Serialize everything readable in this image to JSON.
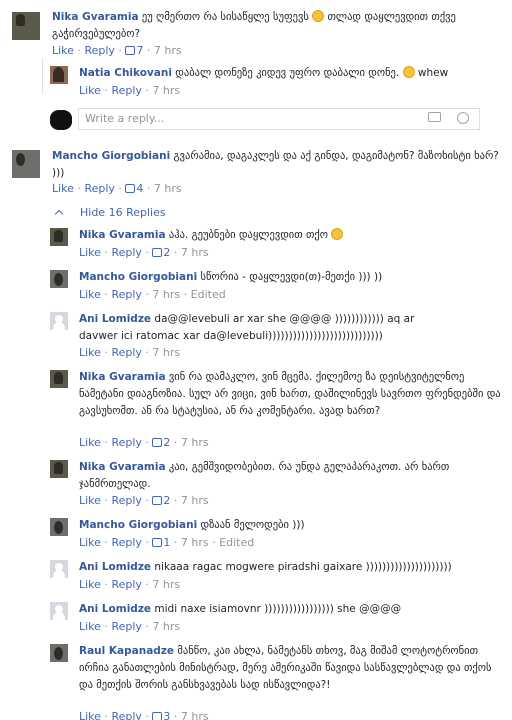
{
  "actions": {
    "like": "Like",
    "reply": "Reply",
    "sep": " · ",
    "edited": "Edited"
  },
  "reply_placeholder": "Write a reply...",
  "hide_replies": "Hide 16 Replies",
  "comments": [
    {
      "author": "Nika Gvaramia",
      "text1": "ეუ ღმერთო რა სისაწყლე სუფევს ",
      "text2": " თლად დაყლევდით თქვე გაჭირვებულებო?",
      "likes": "7",
      "time": "7 hrs"
    },
    {
      "author": "Natia Chikovani",
      "text1": "დაბალ დონეზე კიდევ უფრო დაბალი დონე. ",
      "text2": " whew",
      "time": "7 hrs"
    },
    {
      "author": "Mancho Giorgobiani",
      "text": "გვარამია, დაგაკლეს და აქ გინდა, დაგიმატონ? მაზოხისტი ხარ? )))",
      "likes": "4",
      "time": "7 hrs"
    },
    {
      "author": "Nika Gvaramia",
      "text1": "აჰა. გეუბნები დაყლევდით თქო ",
      "likes": "2",
      "time": "7 hrs"
    },
    {
      "author": "Mancho Giorgobiani",
      "text": "სწორია - დაყლევდი(თ)-მეთქი ))) ))",
      "time": "7 hrs"
    },
    {
      "author": "Ani Lomidze",
      "text": "da@@levebuli ar xar she @@@@ )))))))))))) aq ar davwer ici ratomac xar da@levebuli))))))))))))))))))))))))))))",
      "time": "7 hrs"
    },
    {
      "author": "Nika Gvaramia",
      "text": "ვინ რა დამაკლო, ვინ მცემა. ქილემოე ზა დეისტვიტელნოე ნამეტანი დიაგნოზია. სულ არ ვიცი, ვინ ხართ, დაშილინევს სავრთო ფრენდებში და გავსუხომთ. ან რა სტატუსია, ან რა კომენტარი. ავად ხართ?",
      "likes": "2",
      "time": "7 hrs"
    },
    {
      "author": "Nika Gvaramia",
      "text": "კაი, გემშვიდობებით. რა უნდა გელაპარაკოთ. არ ხართ ჯანმრთელად.",
      "likes": "2",
      "time": "7 hrs"
    },
    {
      "author": "Mancho Giorgobiani",
      "text": "დზაან მელოდები )))",
      "likes": "1",
      "time": "7 hrs"
    },
    {
      "author": "Ani Lomidze",
      "text": "nikaaa ragac mogwere piradshi gaixare )))))))))))))))))))))",
      "time": "7 hrs"
    },
    {
      "author": "Ani Lomidze",
      "text": "midi naxe isiamovnr ))))))))))))))))) she @@@@",
      "time": "7 hrs"
    },
    {
      "author": "Raul Kapanadze",
      "text": "მანწო, კაი ახლა, ნამეტანს თხოვ, მაგ მიშამ ლოტოტრონით ირჩია განათლების მინისტრად, მერე ამერიკაში წავიდა სასწავლებლად და თქოს და მეთქის შორის განსხვავებას სად ისწავლიდა?!",
      "likes": "3",
      "time": "7 hrs"
    }
  ]
}
